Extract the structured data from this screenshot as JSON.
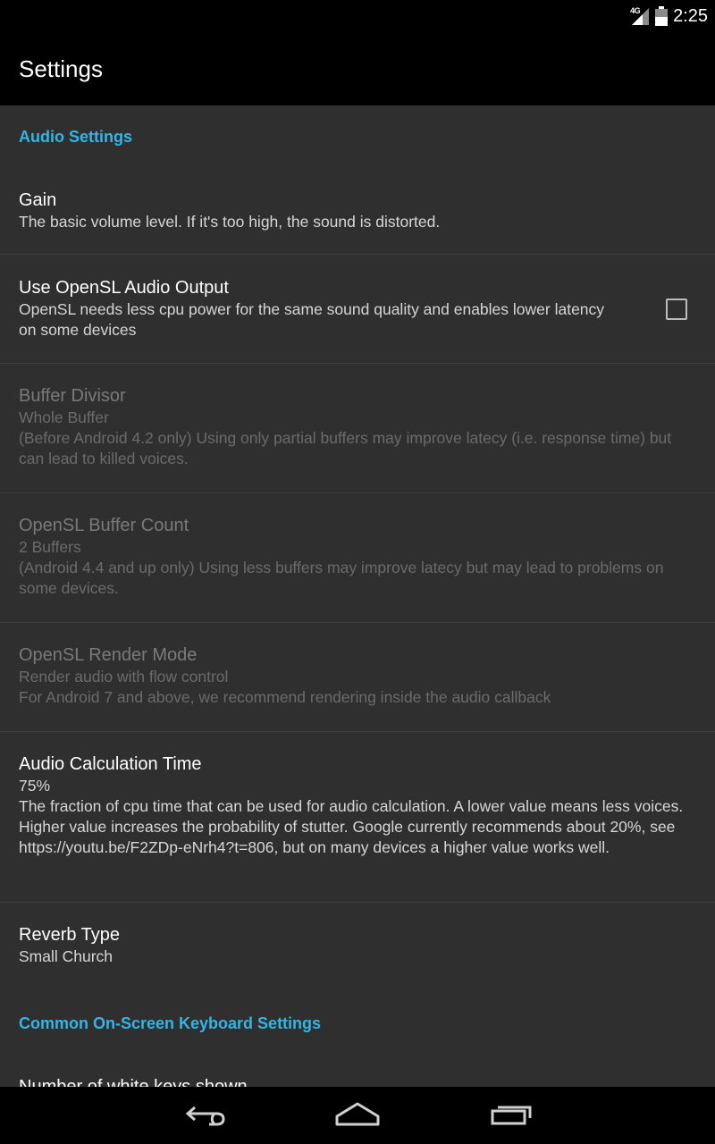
{
  "status": {
    "time": "2:25",
    "network_label": "4G"
  },
  "header": {
    "title": "Settings"
  },
  "sections": [
    {
      "title": "Audio Settings"
    },
    {
      "title": "Common On-Screen Keyboard Settings"
    }
  ],
  "prefs": {
    "gain": {
      "title": "Gain",
      "summary": "The basic volume level. If it's too high, the sound is distorted."
    },
    "opensl_output": {
      "title": "Use OpenSL Audio Output",
      "summary": "OpenSL needs less cpu power for the same sound quality and enables lower latency on some devices",
      "checked": false
    },
    "buffer_divisor": {
      "title": "Buffer Divisor",
      "value": "Whole Buffer",
      "summary": "(Before Android 4.2 only) Using only partial buffers may improve latecy (i.e. response time) but can lead to killed voices."
    },
    "opensl_buffer_count": {
      "title": "OpenSL Buffer Count",
      "value": "2 Buffers",
      "summary": "(Android 4.4 and up only) Using less buffers may improve latecy but may lead to problems on some devices."
    },
    "opensl_render_mode": {
      "title": "OpenSL Render Mode",
      "value": "Render audio with flow control",
      "summary": "For Android 7 and above, we recommend rendering inside the audio callback"
    },
    "audio_calc_time": {
      "title": "Audio Calculation Time",
      "value": "75%",
      "summary": "The fraction of cpu time that can be used for audio calculation. A lower value means less voices. Higher value increases the probability of stutter. Google currently recommends about 20%, see https://youtu.be/F2ZDp-eNrh4?t=806, but on many devices a higher value works well."
    },
    "reverb_type": {
      "title": "Reverb Type",
      "value": "Small Church"
    },
    "white_keys": {
      "title": "Number of white keys shown"
    }
  },
  "colors": {
    "accent": "#33b5e5",
    "background": "#2f2f2f",
    "bar": "#000000",
    "divider": "#3d3d3d"
  },
  "icons": {
    "back": "back-icon",
    "home": "home-icon",
    "recents": "recents-icon",
    "signal": "signal-icon",
    "battery": "battery-icon"
  }
}
